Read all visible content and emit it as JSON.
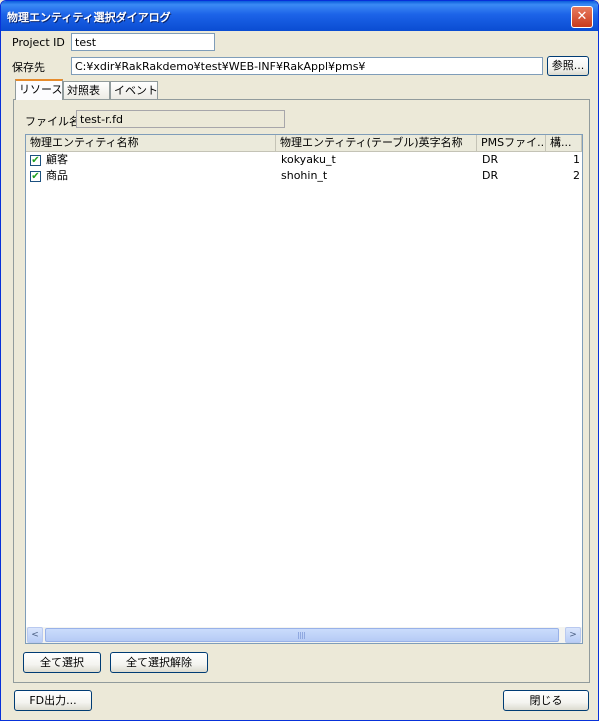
{
  "window": {
    "title": "物理エンティティ選択ダイアログ",
    "close_glyph": "✕"
  },
  "form": {
    "project_id_label": "Project ID",
    "project_id_value": "test",
    "save_to_label": "保存先",
    "save_to_value": "C:¥xdir¥RakRakdemo¥test¥WEB-INF¥RakAppl¥pms¥",
    "browse_label": "参照..."
  },
  "tabs": [
    {
      "label": "リソース",
      "active": true
    },
    {
      "label": "対照表",
      "active": false
    },
    {
      "label": "イベント",
      "active": false
    }
  ],
  "resource": {
    "file_name_label": "ファイル名",
    "file_name_value": "test-r.fd"
  },
  "table": {
    "columns": [
      "物理エンティティ名称",
      "物理エンティティ(テーブル)英字名称",
      "PMSファイ...",
      "構..."
    ],
    "rows": [
      {
        "checked": true,
        "name": "顧客",
        "english_name": "kokyaku_t",
        "pms_file": "DR",
        "struct": "1"
      },
      {
        "checked": true,
        "name": "商品",
        "english_name": "shohin_t",
        "pms_file": "DR",
        "struct": "2"
      }
    ]
  },
  "buttons": {
    "select_all": "全て選択",
    "deselect_all": "全て選択解除",
    "fd_output": "FD出力...",
    "close": "閉じる"
  },
  "scrollbar": {
    "left_glyph": "<",
    "right_glyph": ">",
    "grip_glyph": "|||"
  }
}
